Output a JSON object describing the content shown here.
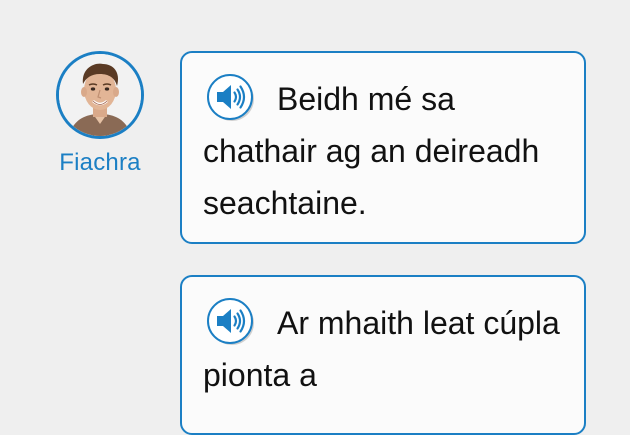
{
  "speaker": {
    "name": "Fiachra",
    "avatar_icon": "person-photo-icon",
    "accent_color": "#1b7fc4"
  },
  "messages": [
    {
      "audio_icon": "speaker-audio-icon",
      "text": "Beidh mé sa chathair ag an deireadh seachtaine."
    },
    {
      "audio_icon": "speaker-audio-icon",
      "text": "Ar mhaith leat cúpla pionta a"
    }
  ]
}
